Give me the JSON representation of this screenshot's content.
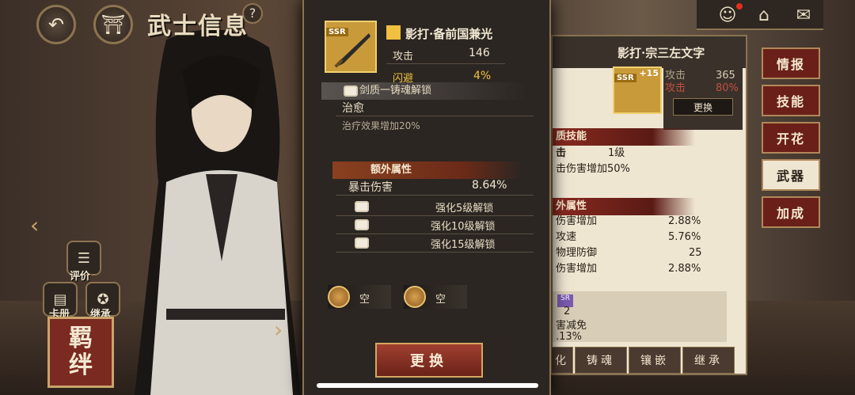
{
  "header": {
    "title": "武士信息",
    "back_icon": "back-arrow-icon",
    "gate_icon": "torii-gate-icon",
    "help": "?"
  },
  "left_actions": {
    "review": "评价",
    "card_book": "卡册",
    "inherit": "继承",
    "bond": [
      "羁",
      "绊"
    ]
  },
  "weapon_popup": {
    "rarity": "SSR",
    "name": "影打·备前国兼光",
    "stats": [
      {
        "label": "攻击",
        "value": "146"
      },
      {
        "label": "闪避",
        "value": "4%"
      }
    ],
    "soul_section": "剑质一铸魂解锁",
    "skill_name": "治愈",
    "skill_desc": "治疗效果增加20%",
    "extra_section": "额外属性",
    "extra_stat": {
      "label": "暴击伤害",
      "value": "8.64%"
    },
    "locked": [
      "强化5级解锁",
      "强化10级解锁",
      "强化15级解锁"
    ],
    "sockets": [
      "空",
      "空"
    ],
    "change_button": "更换"
  },
  "right_panel": {
    "weapon_name": "影打·宗三左文字",
    "rarity": "SSR",
    "level": "+15",
    "stats": [
      {
        "label": "攻击",
        "value": "365"
      },
      {
        "label": "攻击",
        "value": "80%"
      }
    ],
    "change_button": "更换",
    "skill_section": "质技能",
    "skill_row": {
      "label": "击",
      "value": "1级"
    },
    "skill_desc": "击伤害增加50%",
    "extra_section": "外属性",
    "extra_stats": [
      {
        "label": "伤害增加",
        "value": "2.88%"
      },
      {
        "label": "攻速",
        "value": "5.76%"
      },
      {
        "label": "物理防御",
        "value": "25"
      },
      {
        "label": "伤害增加",
        "value": "2.88%"
      }
    ],
    "badge_count": "2",
    "badge_label": "害减免",
    "badge_value": ".13%",
    "bottom_tabs": [
      "化",
      "铸魂",
      "镶嵌",
      "继承"
    ]
  },
  "side_tabs": [
    "情报",
    "技能",
    "开花",
    "武器",
    "加成"
  ],
  "colors": {
    "accent": "#8a2a20",
    "gold": "#f0c040",
    "panel": "#efe6d2"
  }
}
